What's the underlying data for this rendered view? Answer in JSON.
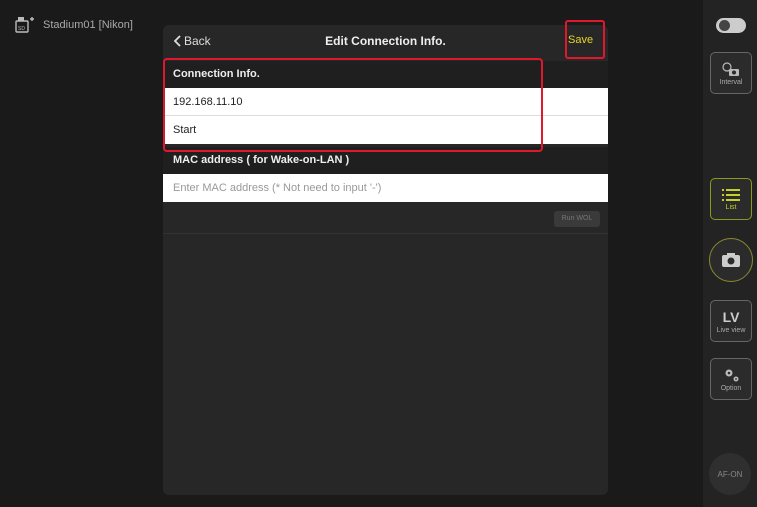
{
  "camera": {
    "name": "Stadium01 [Nikon]"
  },
  "dialog": {
    "back_label": "Back",
    "title": "Edit Connection Info.",
    "save_label": "Save"
  },
  "connection": {
    "header": "Connection Info.",
    "ip": "192.168.11.10",
    "name": "Start"
  },
  "mac": {
    "header": "MAC address ( for Wake-on-LAN )",
    "placeholder": "Enter MAC address (* Not need to input '-')",
    "run_wol": "Run WOL"
  },
  "rail": {
    "interval": "Interval",
    "list": "List",
    "lv_big": "LV",
    "lv_small": "Live view",
    "option": "Option",
    "afon": "AF-ON"
  },
  "colors": {
    "accent": "#e6d62a",
    "highlight": "#e0182d"
  }
}
